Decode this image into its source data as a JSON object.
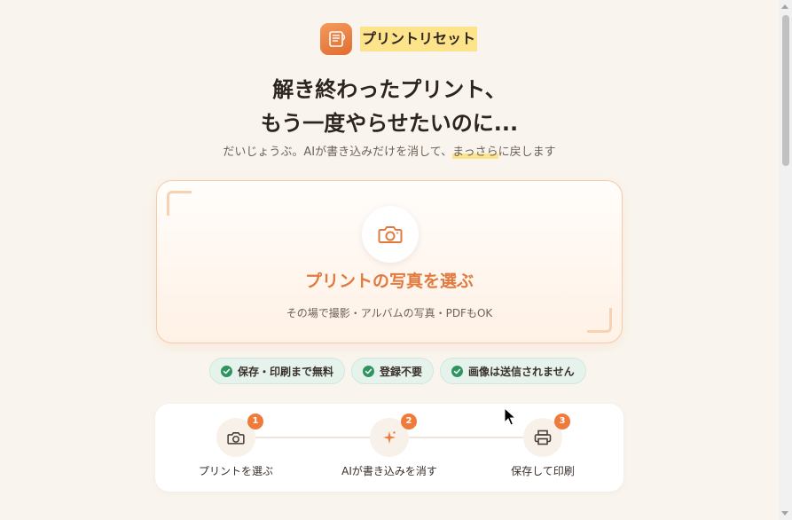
{
  "brand": {
    "name": "プリントリセット",
    "logo_icon": "notebook-reset-icon"
  },
  "hero": {
    "title_line1": "解き終わったプリント、",
    "title_line2": "もう一度やらせたいのに...",
    "subtitle_before": "だいじょうぶ。AIが書き込みだけを消して、",
    "subtitle_mark": "まっさら",
    "subtitle_after": "に戻します"
  },
  "upload": {
    "icon": "camera-icon",
    "title": "プリントの写真を選ぶ",
    "subtitle": "その場で撮影・アルバムの写真・PDFもOK"
  },
  "badges": [
    {
      "label": "保存・印刷まで無料",
      "icon": "check-icon"
    },
    {
      "label": "登録不要",
      "icon": "check-icon"
    },
    {
      "label": "画像は送信されません",
      "icon": "check-icon"
    }
  ],
  "steps": [
    {
      "number": "1",
      "label": "プリントを選ぶ",
      "icon": "camera-icon"
    },
    {
      "number": "2",
      "label": "AIが書き込みを消す",
      "icon": "sparkle-icon"
    },
    {
      "number": "3",
      "label": "保存して印刷",
      "icon": "printer-icon"
    }
  ],
  "colors": {
    "background": "#f9f5ee",
    "accent": "#e07a3f",
    "badge_bg": "#e6f3ec",
    "check": "#2f9560",
    "highlight": "#fde48a"
  }
}
